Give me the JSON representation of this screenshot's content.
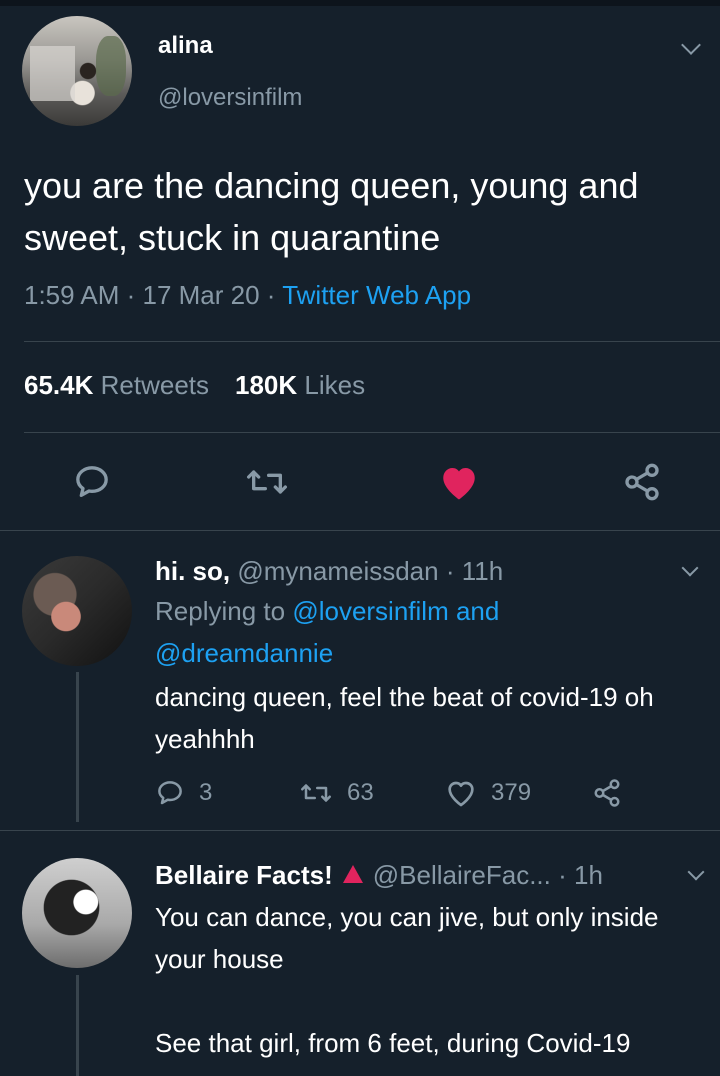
{
  "main_tweet": {
    "name": "alina",
    "handle": "@loversinfilm",
    "text": "you are the dancing queen, young and sweet, stuck in quarantine",
    "time": "1:59 AM · 17 Mar 20 · ",
    "source": "Twitter Web App",
    "retweets_count": "65.4K",
    "retweets_label": "Retweets",
    "likes_count": "180K",
    "likes_label": "Likes"
  },
  "replies": [
    {
      "name": "hi. so,",
      "handle": "@mynameissdan",
      "time": "· 11h",
      "replying_prefix": "Replying to",
      "replying_to_1": "@loversinfilm",
      "replying_and": "and",
      "replying_to_2": "@dreamdannie",
      "text": "dancing queen, feel the beat of covid-19 oh yeahhhh",
      "reply_count": "3",
      "retweet_count": "63",
      "like_count": "379"
    },
    {
      "name": "Bellaire Facts!",
      "handle": "@BellaireFac...",
      "time": "· 1h",
      "text_line1": "You can dance, you can jive, but only inside your house",
      "text_line2": "See that girl, from 6 feet, during Covid-19"
    }
  ],
  "colors": {
    "background": "#15202b",
    "muted": "#8899a6",
    "link": "#1da1f2",
    "like": "#e0245e",
    "divider": "#38444d"
  },
  "icons": {
    "reply": "reply-icon",
    "retweet": "retweet-icon",
    "like": "heart-icon",
    "share": "share-icon"
  }
}
